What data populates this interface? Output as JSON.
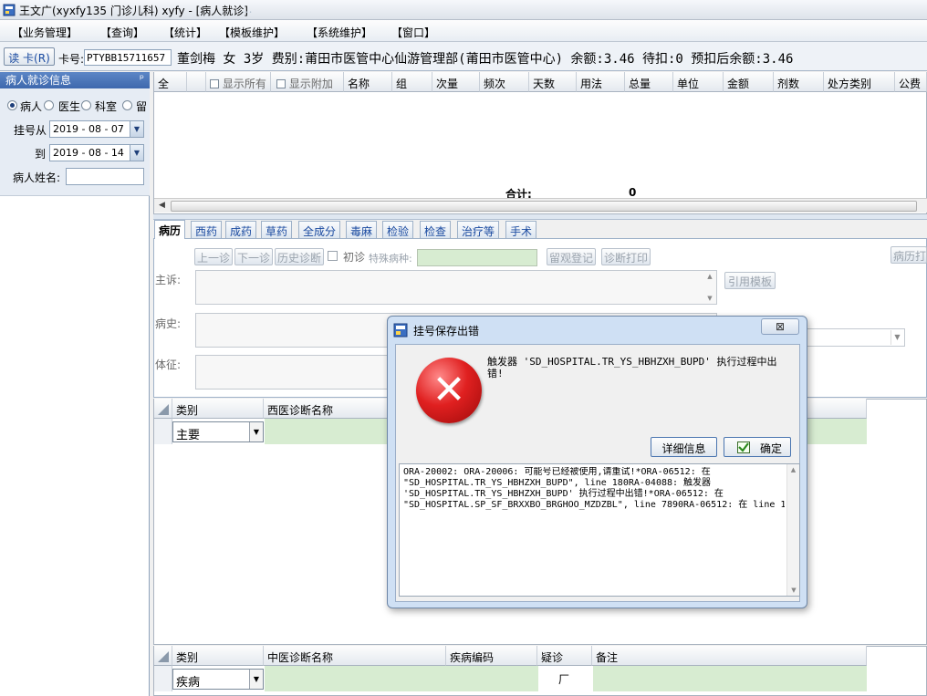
{
  "window": {
    "title": "王文广(xyxfy135 门诊儿科) xyfy - [病人就诊]",
    "extra": "..."
  },
  "menu": [
    "【业务管理】",
    "【查询】",
    "【统计】",
    "【模板维护】",
    "【系统维护】",
    "【窗口】"
  ],
  "patient_bar": {
    "read_card": "读 卡(R)",
    "card_label": "卡号:",
    "card_no": "PTYBB15711657",
    "info": "董剑梅  女  3岁  费别:莆田市医管中心仙游管理部(莆田市医管中心) 余额:3.46 待扣:0 预扣后余额:3.46"
  },
  "left_panel": {
    "title": "病人就诊信息",
    "pin": "ᵖ",
    "radios": [
      {
        "label": "病人",
        "checked": true
      },
      {
        "label": "医生",
        "checked": false
      },
      {
        "label": "科室",
        "checked": false
      },
      {
        "label": "留",
        "checked": false
      }
    ],
    "from_label": "挂号从",
    "from_date": "2019 - 08 - 07",
    "to_label": "到",
    "to_date": "2019 - 08 - 14",
    "name_label": "病人姓名:"
  },
  "rx_grid": {
    "columns": [
      "全",
      "显示所有",
      "显示附加",
      "名称",
      "组",
      "次量",
      "频次",
      "天数",
      "用法",
      "总量",
      "单位",
      "金额",
      "剂数",
      "处方类别",
      "公费"
    ],
    "total_label": "合计:",
    "total_value": "0"
  },
  "tabs": [
    "病历",
    "西药",
    "成药",
    "草药",
    "全成分",
    "毒麻",
    "检验",
    "检查",
    "治疗等",
    "手术"
  ],
  "record": {
    "prev": "上一诊",
    "next": "下一诊",
    "history": "历史诊断",
    "first_visit": "初诊",
    "special": "特殊病种:",
    "observe": "留观登记",
    "print_diag": "诊断打印",
    "print_record": "病历打",
    "complaint_label": "主诉:",
    "cite_template": "引用模板",
    "history_label": "病史:",
    "exam_label": "体征:"
  },
  "western_diag": {
    "columns": [
      "类别",
      "西医诊断名称"
    ],
    "category": "主要"
  },
  "chinese_diag": {
    "columns": [
      "类别",
      "中医诊断名称",
      "疾病编码",
      "疑诊",
      "备注"
    ],
    "category": "疾病",
    "suspect_mark": "厂"
  },
  "dialog": {
    "title": "挂号保存出错",
    "close": "⊠",
    "message": "触发器 'SD_HOSPITAL.TR_YS_HBHZXH_BUPD' 执行过程中出错!",
    "details_button": "详细信息",
    "ok_button": "确定",
    "details": "ORA-20002: ORA-20006: 可能号已经被使用,请重试!*ORA-06512: 在\n\"SD_HOSPITAL.TR_YS_HBHZXH_BUPD\", line 180RA-04088: 触发器\n'SD_HOSPITAL.TR_YS_HBHZXH_BUPD' 执行过程中出错!*ORA-06512: 在\n\"SD_HOSPITAL.SP_SF_BRXXBO_BRGHOO_MZDZBL\", line 7890RA-06512: 在 line 1"
  }
}
